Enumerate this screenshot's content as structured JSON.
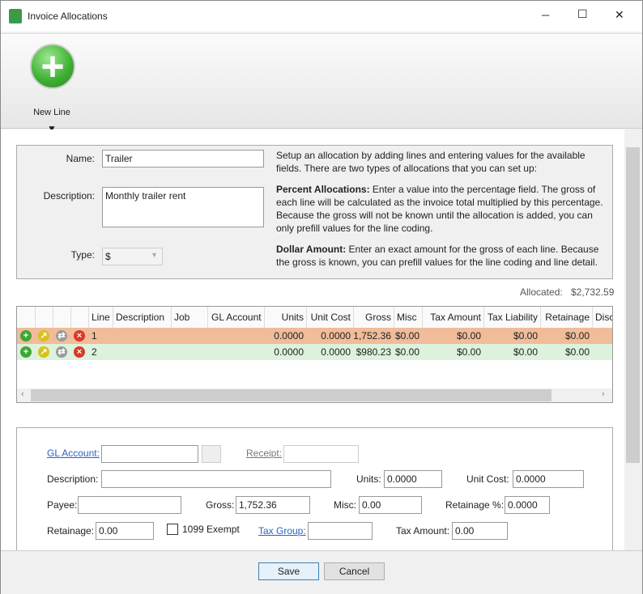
{
  "window": {
    "title": "Invoice Allocations",
    "minimize": "─",
    "maximize": "☐",
    "close": "✕"
  },
  "ribbon": {
    "new_line": "New Line",
    "dropdown_arrow": "▼"
  },
  "form": {
    "name_label": "Name:",
    "name_value": "Trailer",
    "description_label": "Description:",
    "description_value": "Monthly trailer rent",
    "type_label": "Type:",
    "type_value": "$"
  },
  "help": {
    "intro": "Setup an allocation by adding lines and entering values for the available fields. There are two types of allocations that you can set up:",
    "percent_title": "Percent Allocations:",
    "percent_text": " Enter a value into the percentage field. The gross of each line will be calculated as the invoice total multiplied by this percentage. Because the gross will not be known until the allocation is added, you can only prefill values for the line coding.",
    "dollar_title": "Dollar Amount:",
    "dollar_text": " Enter an exact amount for the gross of each line. Because the gross is known, you can prefill values for the line coding and line detail."
  },
  "allocated": {
    "label": "Allocated:",
    "value": "$2,732.59"
  },
  "grid": {
    "columns": [
      "Line",
      "Description",
      "Job",
      "GL Account",
      "Units",
      "Unit Cost",
      "Gross",
      "Misc",
      "Tax Amount",
      "Tax Liability",
      "Retainage",
      "Disc"
    ],
    "rows": [
      {
        "line": "1",
        "units": "0.0000",
        "unit_cost": "0.0000",
        "gross": "$1,752.36",
        "misc": "$0.00",
        "tax_amount": "$0.00",
        "tax_liability": "$0.00",
        "retainage": "$0.00",
        "color": "#f0bc9a"
      },
      {
        "line": "2",
        "units": "0.0000",
        "unit_cost": "0.0000",
        "gross": "$980.23",
        "misc": "$0.00",
        "tax_amount": "$0.00",
        "tax_liability": "$0.00",
        "retainage": "$0.00",
        "color": "#dcf2dc"
      }
    ]
  },
  "detail": {
    "gl_account": "GL Account:",
    "receipt": "Receipt:",
    "description": "Description:",
    "units": "Units:",
    "units_value": "0.0000",
    "unit_cost": "Unit Cost:",
    "unit_cost_value": "0.0000",
    "payee": "Payee:",
    "gross": "Gross:",
    "gross_value": "1,752.36",
    "misc": "Misc:",
    "misc_value": "0.00",
    "retainage_pct": "Retainage %:",
    "retainage_pct_value": "0.0000",
    "retainage": "Retainage:",
    "retainage_value": "0.00",
    "exempt": "1099 Exempt",
    "tax_group": "Tax Group:",
    "tax_amount": "Tax Amount:",
    "tax_amount_value": "0.00"
  },
  "footer": {
    "save": "Save",
    "cancel": "Cancel"
  }
}
